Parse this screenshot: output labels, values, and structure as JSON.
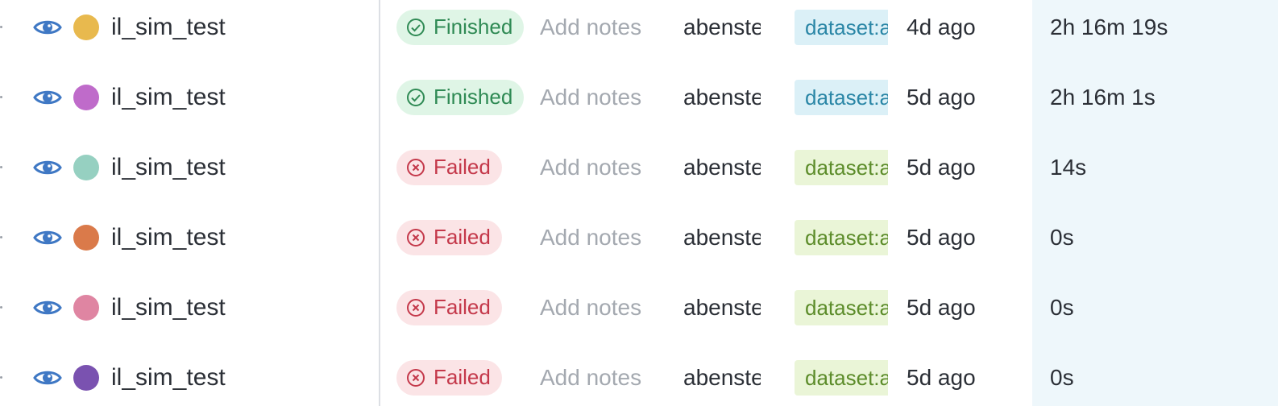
{
  "colors": {
    "eye_icon": "#3f78c4",
    "finished_bg": "#dff5e6",
    "finished_fg": "#2f8a54",
    "failed_bg": "#fbe4e6",
    "failed_fg": "#c4384a",
    "notes_placeholder": "#a4a9b0",
    "runtime_column_bg": "#eef7fb"
  },
  "rows": [
    {
      "name": "il_sim_test",
      "color": "#e8b94e",
      "state": "Finished",
      "state_kind": "finished",
      "notes_placeholder": "Add notes",
      "user": "abenstein",
      "tag": "dataset:a",
      "tag_kind": "blue",
      "created": "4d ago",
      "runtime": "2h 16m 19s"
    },
    {
      "name": "il_sim_test",
      "color": "#bf6bca",
      "state": "Finished",
      "state_kind": "finished",
      "notes_placeholder": "Add notes",
      "user": "abenstein",
      "tag": "dataset:a",
      "tag_kind": "blue",
      "created": "5d ago",
      "runtime": "2h 16m 1s"
    },
    {
      "name": "il_sim_test",
      "color": "#96d0c1",
      "state": "Failed",
      "state_kind": "failed",
      "notes_placeholder": "Add notes",
      "user": "abenstein",
      "tag": "dataset:a",
      "tag_kind": "green",
      "created": "5d ago",
      "runtime": "14s"
    },
    {
      "name": "il_sim_test",
      "color": "#da7a4a",
      "state": "Failed",
      "state_kind": "failed",
      "notes_placeholder": "Add notes",
      "user": "abenstein",
      "tag": "dataset:a",
      "tag_kind": "green",
      "created": "5d ago",
      "runtime": "0s"
    },
    {
      "name": "il_sim_test",
      "color": "#df85a2",
      "state": "Failed",
      "state_kind": "failed",
      "notes_placeholder": "Add notes",
      "user": "abenstein",
      "tag": "dataset:a",
      "tag_kind": "green",
      "created": "5d ago",
      "runtime": "0s"
    },
    {
      "name": "il_sim_test",
      "color": "#7a52b0",
      "state": "Failed",
      "state_kind": "failed",
      "notes_placeholder": "Add notes",
      "user": "abenstein",
      "tag": "dataset:a",
      "tag_kind": "green",
      "created": "5d ago",
      "runtime": "0s"
    }
  ]
}
